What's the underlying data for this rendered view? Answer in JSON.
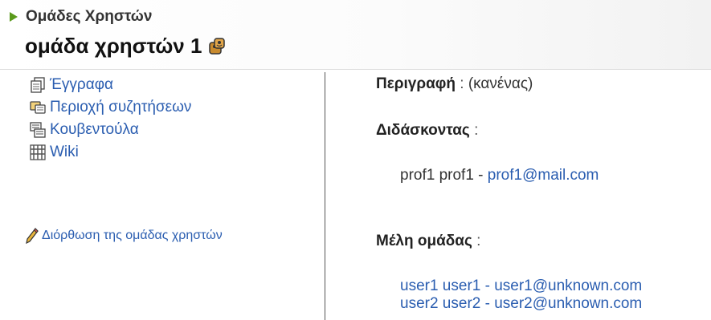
{
  "breadcrumb": {
    "label": "Ομάδες Χρηστών"
  },
  "page": {
    "title": "ομάδα χρηστών 1"
  },
  "menu": {
    "items": [
      {
        "label": "Έγγραφα",
        "icon": "documents-icon"
      },
      {
        "label": "Περιοχή συζητήσεων",
        "icon": "forum-icon"
      },
      {
        "label": "Κουβεντούλα",
        "icon": "chat-icon"
      },
      {
        "label": "Wiki",
        "icon": "wiki-icon"
      }
    ],
    "edit_label": "Διόρθωση της ομάδας χρηστών"
  },
  "details": {
    "description_label": "Περιγραφή",
    "description_value": "(κανένας)",
    "separator": ":",
    "tutor_label": "Διδάσκοντας",
    "tutor_name": "prof1 prof1 - ",
    "tutor_email": "prof1@mail.com",
    "members_label": "Μέλη ομάδας",
    "members": [
      "user1 user1 - user1@unknown.com",
      "user2 user2 - user2@unknown.com"
    ]
  },
  "colors": {
    "link": "#2a5db0",
    "arrow": "#5a9a1c"
  }
}
